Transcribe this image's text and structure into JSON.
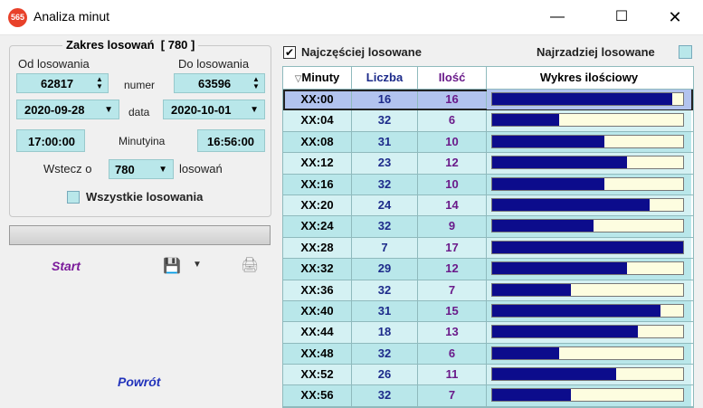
{
  "window": {
    "title": "Analiza minut",
    "app_icon_text": "565"
  },
  "range": {
    "group_title": "Zakres losowań",
    "group_count": "[ 780 ]",
    "from_label": "Od losowania",
    "to_label": "Do losowania",
    "from_number": "62817",
    "to_number": "63596",
    "number_label": "numer",
    "from_date": "2020-09-28",
    "to_date": "2020-10-01",
    "date_label": "data",
    "from_time": "17:00:00",
    "to_time": "16:56:00",
    "time_label": "Minutyina",
    "back_label": "Wstecz o",
    "back_value": "780",
    "back_suffix": "losowań",
    "all_label": "Wszystkie losowania"
  },
  "actions": {
    "start": "Start",
    "back": "Powrót"
  },
  "options": {
    "most_label": "Najczęściej losowane",
    "most_checked": true,
    "least_label": "Najrzadziej losowane",
    "least_checked": false
  },
  "table": {
    "headers": [
      "Minuty",
      "Liczba",
      "Ilość",
      "Wykres ilościowy"
    ],
    "max": 17,
    "rows": [
      {
        "minute": "XX:00",
        "number": "16",
        "count": "16"
      },
      {
        "minute": "XX:04",
        "number": "32",
        "count": "6"
      },
      {
        "minute": "XX:08",
        "number": "31",
        "count": "10"
      },
      {
        "minute": "XX:12",
        "number": "23",
        "count": "12"
      },
      {
        "minute": "XX:16",
        "number": "32",
        "count": "10"
      },
      {
        "minute": "XX:20",
        "number": "24",
        "count": "14"
      },
      {
        "minute": "XX:24",
        "number": "32",
        "count": "9"
      },
      {
        "minute": "XX:28",
        "number": "7",
        "count": "17"
      },
      {
        "minute": "XX:32",
        "number": "29",
        "count": "12"
      },
      {
        "minute": "XX:36",
        "number": "32",
        "count": "7"
      },
      {
        "minute": "XX:40",
        "number": "31",
        "count": "15"
      },
      {
        "minute": "XX:44",
        "number": "18",
        "count": "13"
      },
      {
        "minute": "XX:48",
        "number": "32",
        "count": "6"
      },
      {
        "minute": "XX:52",
        "number": "26",
        "count": "11"
      },
      {
        "minute": "XX:56",
        "number": "32",
        "count": "7"
      }
    ]
  }
}
